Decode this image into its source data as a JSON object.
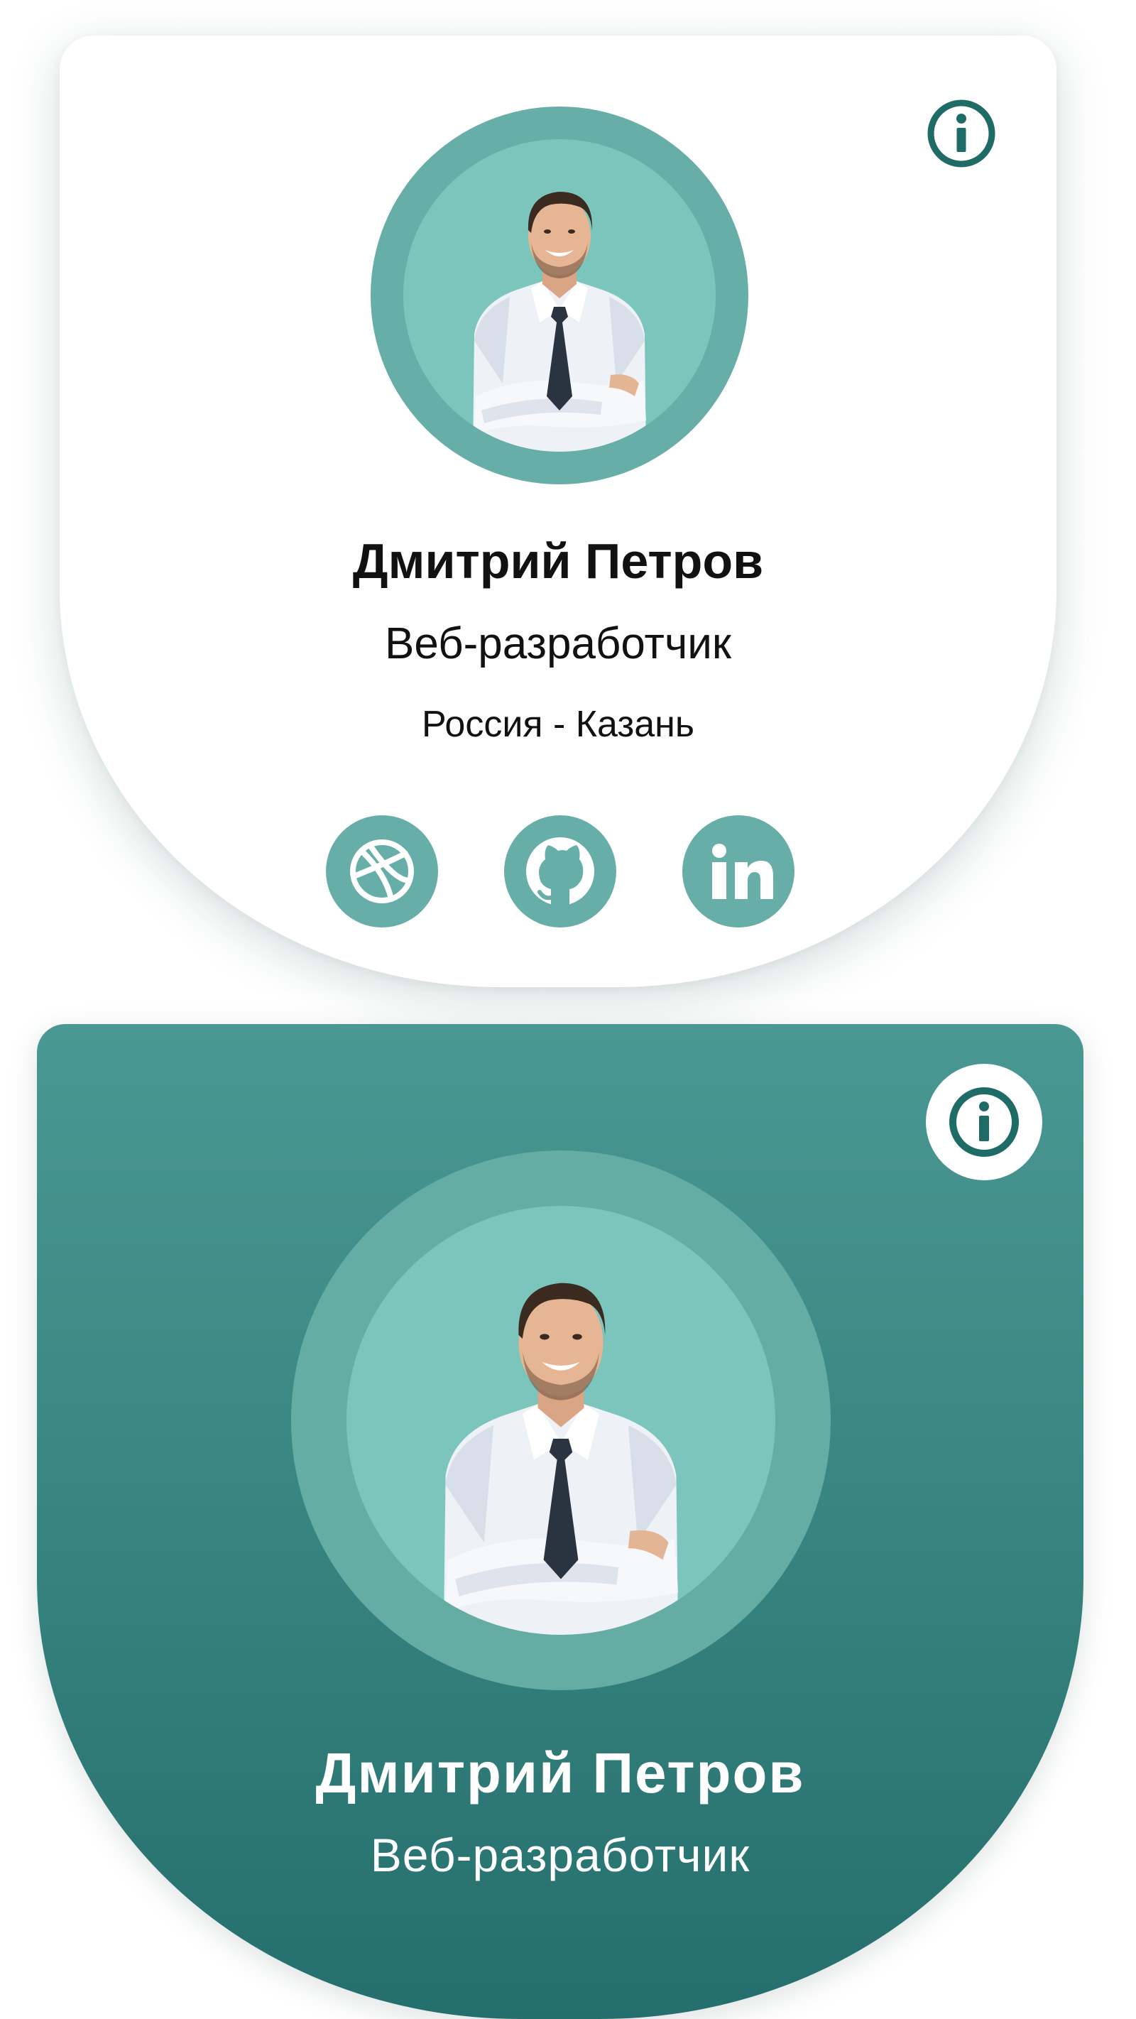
{
  "colors": {
    "accent": "#67aea8",
    "accent_light": "#7bc5bd",
    "icon_dark": "#1f6b66",
    "card_dark_top": "#4a9893",
    "card_dark_bottom": "#246f6d",
    "text_dark": "#111111",
    "text_light": "#ffffff"
  },
  "card_light": {
    "info_icon": "info-circle-icon",
    "avatar": "profile-photo-man-in-shirt-and-tie",
    "name": "Дмитрий Петров",
    "role": "Веб-разработчик",
    "location": "Россия - Казань",
    "social": [
      {
        "icon": "dribbble-icon"
      },
      {
        "icon": "github-icon"
      },
      {
        "icon": "linkedin-icon"
      }
    ]
  },
  "card_dark": {
    "info_icon": "info-circle-icon",
    "avatar": "profile-photo-man-in-shirt-and-tie",
    "name": "Дмитрий Петров",
    "role": "Веб-разработчик"
  }
}
